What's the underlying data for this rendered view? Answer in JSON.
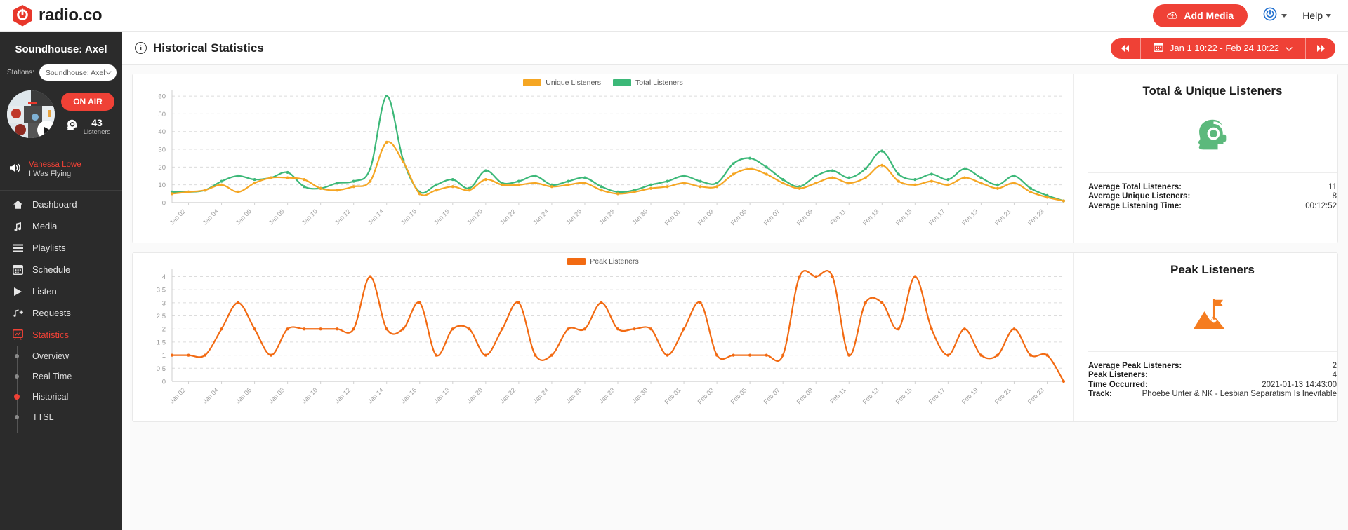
{
  "brand": {
    "name": "radio.co"
  },
  "topbar": {
    "add_media_label": "Add Media",
    "help_label": "Help",
    "power_icon": "power-icon",
    "cloud_icon": "cloud-upload-icon"
  },
  "sidebar": {
    "station_title": "Soundhouse: Axel",
    "stations_label": "Stations:",
    "station_selected": "Soundhouse: Axel",
    "on_air_label": "ON AIR",
    "listeners_count": "43",
    "listeners_label": "Listeners",
    "now_playing": {
      "artist": "Vanessa Lowe",
      "track": "I Was Flying"
    },
    "nav": [
      {
        "label": "Dashboard",
        "icon": "home-icon",
        "active": false
      },
      {
        "label": "Media",
        "icon": "music-note-icon",
        "active": false
      },
      {
        "label": "Playlists",
        "icon": "list-icon",
        "active": false
      },
      {
        "label": "Schedule",
        "icon": "calendar-icon",
        "active": false
      },
      {
        "label": "Listen",
        "icon": "play-icon",
        "active": false
      },
      {
        "label": "Requests",
        "icon": "music-add-icon",
        "active": false
      },
      {
        "label": "Statistics",
        "icon": "statistics-icon",
        "active": true
      }
    ],
    "subnav": [
      {
        "label": "Overview",
        "active": false
      },
      {
        "label": "Real Time",
        "active": false
      },
      {
        "label": "Historical",
        "active": true
      },
      {
        "label": "TTSL",
        "active": false
      }
    ]
  },
  "page": {
    "title": "Historical Statistics",
    "date_range": "Jan 1 10:22 - Feb 24 10:22",
    "prev_icon": "double-chevron-left-icon",
    "next_icon": "double-chevron-right-icon",
    "calendar_icon": "calendar-icon"
  },
  "panels": {
    "listeners": {
      "title": "Total & Unique Listeners",
      "icon": "head-headphones-icon",
      "icon_color": "#5cb97c",
      "stats": [
        {
          "key": "Average Total Listeners:",
          "value": "11"
        },
        {
          "key": "Average Unique Listeners:",
          "value": "8"
        },
        {
          "key": "Average Listening Time:",
          "value": "00:12:52"
        }
      ]
    },
    "peak": {
      "title": "Peak Listeners",
      "icon": "mountain-flag-icon",
      "icon_color": "#f57c1f",
      "stats": [
        {
          "key": "Average Peak Listeners:",
          "value": "2"
        },
        {
          "key": "Peak Listeners:",
          "value": "4"
        },
        {
          "key": "Time Occurred:",
          "value": "2021-01-13 14:43:00"
        },
        {
          "key": "Track:",
          "value": "Phoebe Unter & NK - Lesbian Separatism Is Inevitable"
        }
      ]
    }
  },
  "chart_data": [
    {
      "type": "line",
      "title": "",
      "xlabel": "",
      "ylabel": "",
      "ylim": [
        0,
        62
      ],
      "yticks": [
        0,
        10,
        20,
        30,
        40,
        50,
        60
      ],
      "grid": true,
      "legend_position": "top-center",
      "colors": {
        "Unique Listeners": "#f5a623",
        "Total Listeners": "#3cb878"
      },
      "x": [
        "Jan 01",
        "Jan 02",
        "Jan 03",
        "Jan 04",
        "Jan 05",
        "Jan 06",
        "Jan 07",
        "Jan 08",
        "Jan 09",
        "Jan 10",
        "Jan 11",
        "Jan 12",
        "Jan 13",
        "Jan 14",
        "Jan 15",
        "Jan 16",
        "Jan 17",
        "Jan 18",
        "Jan 19",
        "Jan 20",
        "Jan 21",
        "Jan 22",
        "Jan 23",
        "Jan 24",
        "Jan 25",
        "Jan 26",
        "Jan 27",
        "Jan 28",
        "Jan 29",
        "Jan 30",
        "Jan 31",
        "Feb 01",
        "Feb 02",
        "Feb 03",
        "Feb 04",
        "Feb 05",
        "Feb 06",
        "Feb 07",
        "Feb 08",
        "Feb 09",
        "Feb 10",
        "Feb 11",
        "Feb 12",
        "Feb 13",
        "Feb 14",
        "Feb 15",
        "Feb 16",
        "Feb 17",
        "Feb 18",
        "Feb 19",
        "Feb 20",
        "Feb 21",
        "Feb 22",
        "Feb 23",
        "Feb 24"
      ],
      "xticks": [
        "Jan 02",
        "Jan 04",
        "Jan 06",
        "Jan 08",
        "Jan 10",
        "Jan 12",
        "Jan 14",
        "Jan 16",
        "Jan 18",
        "Jan 20",
        "Jan 22",
        "Jan 24",
        "Jan 26",
        "Jan 28",
        "Jan 30",
        "Feb 01",
        "Feb 03",
        "Feb 05",
        "Feb 07",
        "Feb 09",
        "Feb 11",
        "Feb 13",
        "Feb 15",
        "Feb 17",
        "Feb 19",
        "Feb 21",
        "Feb 23"
      ],
      "series": [
        {
          "name": "Total Listeners",
          "values": [
            6,
            6,
            7,
            12,
            15,
            13,
            14,
            17,
            9,
            8,
            11,
            12,
            19,
            60,
            24,
            6,
            10,
            13,
            8,
            18,
            11,
            12,
            15,
            10,
            12,
            14,
            9,
            6,
            7,
            10,
            12,
            15,
            12,
            11,
            22,
            25,
            20,
            13,
            9,
            15,
            18,
            14,
            19,
            29,
            16,
            13,
            16,
            13,
            19,
            14,
            10,
            15,
            8,
            4,
            1
          ]
        },
        {
          "name": "Unique Listeners",
          "values": [
            5,
            6,
            7,
            10,
            6,
            11,
            14,
            14,
            13,
            8,
            7,
            9,
            12,
            34,
            23,
            5,
            7,
            9,
            7,
            13,
            10,
            10,
            11,
            9,
            10,
            11,
            7,
            5,
            6,
            8,
            9,
            11,
            9,
            9,
            16,
            19,
            16,
            11,
            8,
            11,
            14,
            11,
            14,
            21,
            12,
            10,
            12,
            10,
            14,
            11,
            8,
            11,
            6,
            3,
            1
          ]
        }
      ]
    },
    {
      "type": "line",
      "title": "",
      "xlabel": "",
      "ylabel": "",
      "ylim": [
        0,
        4.2
      ],
      "yticks": [
        0,
        0.5,
        1,
        1.5,
        2,
        2.5,
        3,
        3.5,
        4
      ],
      "grid": true,
      "legend_position": "top-center",
      "colors": {
        "Peak Listeners": "#f26a12"
      },
      "x": [
        "Jan 01",
        "Jan 02",
        "Jan 03",
        "Jan 04",
        "Jan 05",
        "Jan 06",
        "Jan 07",
        "Jan 08",
        "Jan 09",
        "Jan 10",
        "Jan 11",
        "Jan 12",
        "Jan 13",
        "Jan 14",
        "Jan 15",
        "Jan 16",
        "Jan 17",
        "Jan 18",
        "Jan 19",
        "Jan 20",
        "Jan 21",
        "Jan 22",
        "Jan 23",
        "Jan 24",
        "Jan 25",
        "Jan 26",
        "Jan 27",
        "Jan 28",
        "Jan 29",
        "Jan 30",
        "Jan 31",
        "Feb 01",
        "Feb 02",
        "Feb 03",
        "Feb 04",
        "Feb 05",
        "Feb 06",
        "Feb 07",
        "Feb 08",
        "Feb 09",
        "Feb 10",
        "Feb 11",
        "Feb 12",
        "Feb 13",
        "Feb 14",
        "Feb 15",
        "Feb 16",
        "Feb 17",
        "Feb 18",
        "Feb 19",
        "Feb 20",
        "Feb 21",
        "Feb 22",
        "Feb 23",
        "Feb 24"
      ],
      "xticks": [
        "Jan 02",
        "Jan 04",
        "Jan 06",
        "Jan 08",
        "Jan 10",
        "Jan 12",
        "Jan 14",
        "Jan 16",
        "Jan 18",
        "Jan 20",
        "Jan 22",
        "Jan 24",
        "Jan 26",
        "Jan 28",
        "Jan 30",
        "Feb 01",
        "Feb 03",
        "Feb 05",
        "Feb 07",
        "Feb 09",
        "Feb 11",
        "Feb 13",
        "Feb 15",
        "Feb 17",
        "Feb 19",
        "Feb 21",
        "Feb 23"
      ],
      "series": [
        {
          "name": "Peak Listeners",
          "values": [
            1,
            1,
            1,
            2,
            3,
            2,
            1,
            2,
            2,
            2,
            2,
            2,
            4,
            2,
            2,
            3,
            1,
            2,
            2,
            1,
            2,
            3,
            1,
            1,
            2,
            2,
            3,
            2,
            2,
            2,
            1,
            2,
            3,
            1,
            1,
            1,
            1,
            1,
            4,
            4,
            4,
            1,
            3,
            3,
            2,
            4,
            2,
            1,
            2,
            1,
            1,
            2,
            1,
            1,
            0
          ]
        }
      ]
    }
  ]
}
